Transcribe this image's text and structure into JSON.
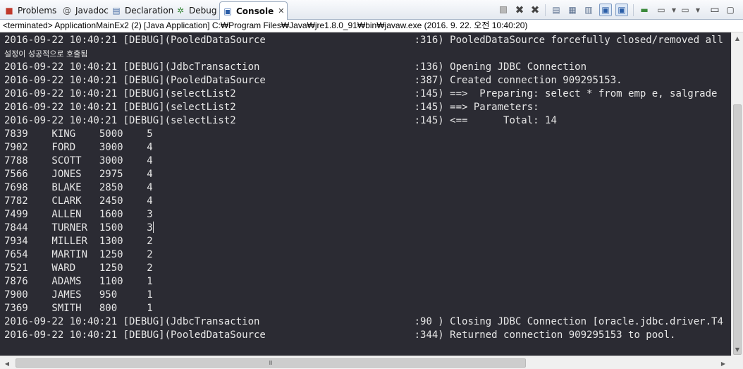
{
  "tabs": [
    {
      "label": "Problems",
      "icon": "problems-icon"
    },
    {
      "label": "Javadoc",
      "icon": "javadoc-icon"
    },
    {
      "label": "Declaration",
      "icon": "declaration-icon"
    },
    {
      "label": "Debug",
      "icon": "debug-icon"
    },
    {
      "label": "Console",
      "icon": "console-icon",
      "close": "✕"
    }
  ],
  "status": "<terminated> ApplicationMainEx2 (2) [Java Application] C:₩Program Files₩Java₩jre1.8.0_91₩bin₩javaw.exe (2016. 9. 22. 오전 10:40:20)",
  "console": {
    "log_lines": [
      "2016-09-22 10:40:21 [DEBUG](PooledDataSource                         :316) PooledDataSource forcefully closed/removed all",
      "2016-09-22 10:40:21 [DEBUG](JdbcTransaction                          :136) Opening JDBC Connection",
      "2016-09-22 10:40:21 [DEBUG](PooledDataSource                         :387) Created connection 909295153.",
      "2016-09-22 10:40:21 [DEBUG](selectList2                              :145) ==>  Preparing: select * from emp e, salgrade",
      "2016-09-22 10:40:21 [DEBUG](selectList2                              :145) ==> Parameters: ",
      "2016-09-22 10:40:21 [DEBUG](selectList2                              :145) <==      Total: 14"
    ],
    "korean_line": "설정이 성공적으로 호출됨",
    "rows": [
      [
        "7839",
        "KING",
        "5000",
        "5"
      ],
      [
        "7902",
        "FORD",
        "3000",
        "4"
      ],
      [
        "7788",
        "SCOTT",
        "3000",
        "4"
      ],
      [
        "7566",
        "JONES",
        "2975",
        "4"
      ],
      [
        "7698",
        "BLAKE",
        "2850",
        "4"
      ],
      [
        "7782",
        "CLARK",
        "2450",
        "4"
      ],
      [
        "7499",
        "ALLEN",
        "1600",
        "3"
      ],
      [
        "7844",
        "TURNER",
        "1500",
        "3"
      ],
      [
        "7934",
        "MILLER",
        "1300",
        "2"
      ],
      [
        "7654",
        "MARTIN",
        "1250",
        "2"
      ],
      [
        "7521",
        "WARD",
        "1250",
        "2"
      ],
      [
        "7876",
        "ADAMS",
        "1100",
        "1"
      ],
      [
        "7900",
        "JAMES",
        "950",
        "1"
      ],
      [
        "7369",
        "SMITH",
        "800",
        "1"
      ]
    ],
    "tail_lines": [
      "2016-09-22 10:40:21 [DEBUG](JdbcTransaction                          :90 ) Closing JDBC Connection [oracle.jdbc.driver.T4",
      "2016-09-22 10:40:21 [DEBUG](PooledDataSource                         :344) Returned connection 909295153 to pool."
    ]
  },
  "scrollbar": {
    "h_grip": "Ⅲ"
  },
  "colors": {
    "console_bg": "#2b2b33",
    "console_fg": "#e6e6e6"
  }
}
